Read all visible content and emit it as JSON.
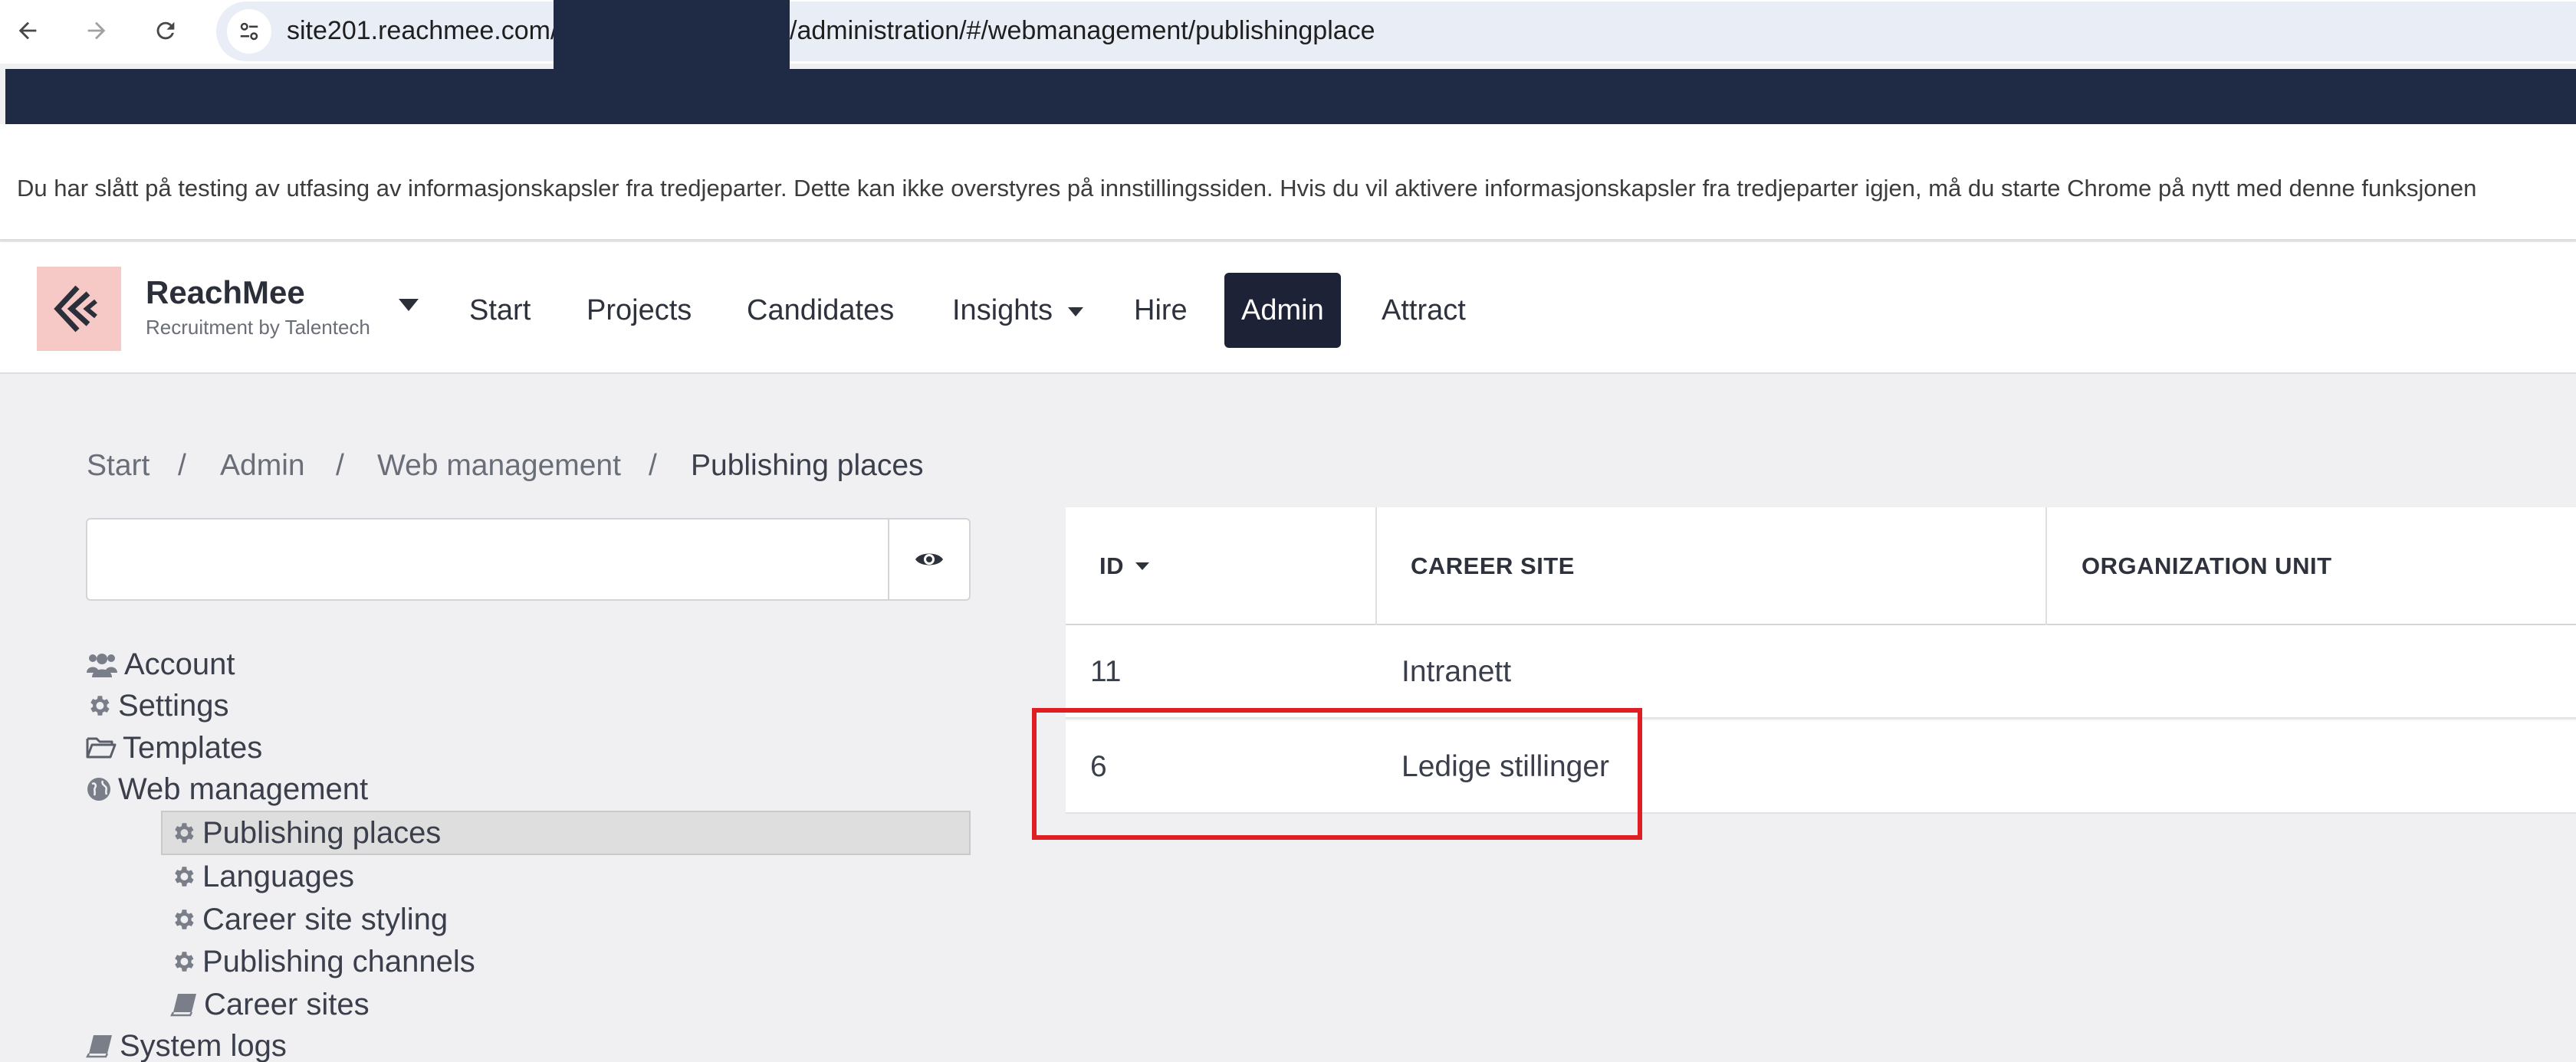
{
  "browser": {
    "url_prefix": "site201.reachmee.com/",
    "url_suffix": "/administration/#/webmanagement/publishingplace",
    "back_icon": "arrow-left-icon",
    "forward_icon": "arrow-right-icon",
    "reload_icon": "reload-icon",
    "site_info_icon": "tune-icon"
  },
  "infobar": {
    "text": "Du har slått på testing av utfasing av informasjonskapsler fra tredjeparter. Dette kan ikke overstyres på innstillingssiden. Hvis du vil aktivere informasjonskapsler fra tredjeparter igjen, må du starte Chrome på nytt med denne funksjonen"
  },
  "header": {
    "brand_name": "ReachMee",
    "brand_sub": "Recruitment by Talentech",
    "nav": [
      "Start",
      "Projects",
      "Candidates",
      "Insights",
      "Hire",
      "Admin",
      "Attract"
    ],
    "active_nav": "Admin"
  },
  "breadcrumb": {
    "items": [
      "Start",
      "Admin",
      "Web management",
      "Publishing places"
    ],
    "separator": "/"
  },
  "search": {
    "value": "",
    "placeholder": "",
    "toggle_icon": "eye-icon"
  },
  "tree": [
    {
      "label": "Account",
      "icon": "users-icon",
      "level": 0
    },
    {
      "label": "Settings",
      "icon": "gear-icon",
      "level": 0
    },
    {
      "label": "Templates",
      "icon": "folder-open-icon",
      "level": 0
    },
    {
      "label": "Web management",
      "icon": "globe-icon",
      "level": 0
    },
    {
      "label": "Publishing places",
      "icon": "gear-icon",
      "level": 1,
      "selected": true
    },
    {
      "label": "Languages",
      "icon": "gear-icon",
      "level": 1
    },
    {
      "label": "Career site styling",
      "icon": "gear-icon",
      "level": 1
    },
    {
      "label": "Publishing channels",
      "icon": "gear-icon",
      "level": 1
    },
    {
      "label": "Career sites",
      "icon": "book-icon",
      "level": 1
    },
    {
      "label": "System logs",
      "icon": "book-icon",
      "level": 0
    }
  ],
  "table": {
    "columns": [
      "ID",
      "CAREER SITE",
      "ORGANIZATION UNIT"
    ],
    "sort_column": "ID",
    "sort_direction": "desc",
    "rows": [
      {
        "id": "11",
        "career_site": "Intranett",
        "organization_unit": ""
      },
      {
        "id": "6",
        "career_site": "Ledige stillinger",
        "organization_unit": ""
      }
    ]
  },
  "colors": {
    "header_dark": "#1f2b44",
    "active_nav_bg": "#1e2236",
    "logo_bg": "#f6c9c7",
    "highlight": "#e11d24"
  }
}
